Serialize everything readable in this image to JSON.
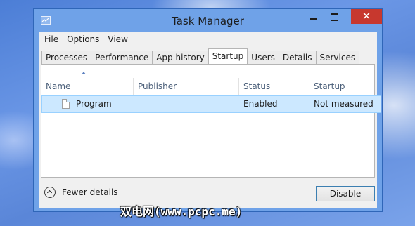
{
  "window": {
    "title": "Task Manager",
    "close_glyph": "✕",
    "icons": {
      "app": "task-manager-icon",
      "minimize": "minimize-icon",
      "maximize": "maximize-icon",
      "close": "close-icon"
    }
  },
  "menu": {
    "items": [
      "File",
      "Options",
      "View"
    ]
  },
  "tabs": [
    {
      "label": "Processes",
      "active": false
    },
    {
      "label": "Performance",
      "active": false
    },
    {
      "label": "App history",
      "active": false
    },
    {
      "label": "Startup",
      "active": true
    },
    {
      "label": "Users",
      "active": false
    },
    {
      "label": "Details",
      "active": false
    },
    {
      "label": "Services",
      "active": false
    }
  ],
  "table": {
    "columns": [
      "Name",
      "Publisher",
      "Status",
      "Startup impact"
    ],
    "sort_column": "Name",
    "sort_direction": "ascending",
    "rows": [
      {
        "icon": "document-icon",
        "name": "Program",
        "publisher": "",
        "status": "Enabled",
        "impact": "Not measured",
        "selected": true
      }
    ]
  },
  "footer": {
    "fewer_details": "Fewer details",
    "disable": "Disable"
  },
  "watermark": "双电网(www.pcpc.me)",
  "colors": {
    "selection": "#cce8ff",
    "close_button": "#c7382e",
    "window_frame": "#6fa2e8"
  }
}
